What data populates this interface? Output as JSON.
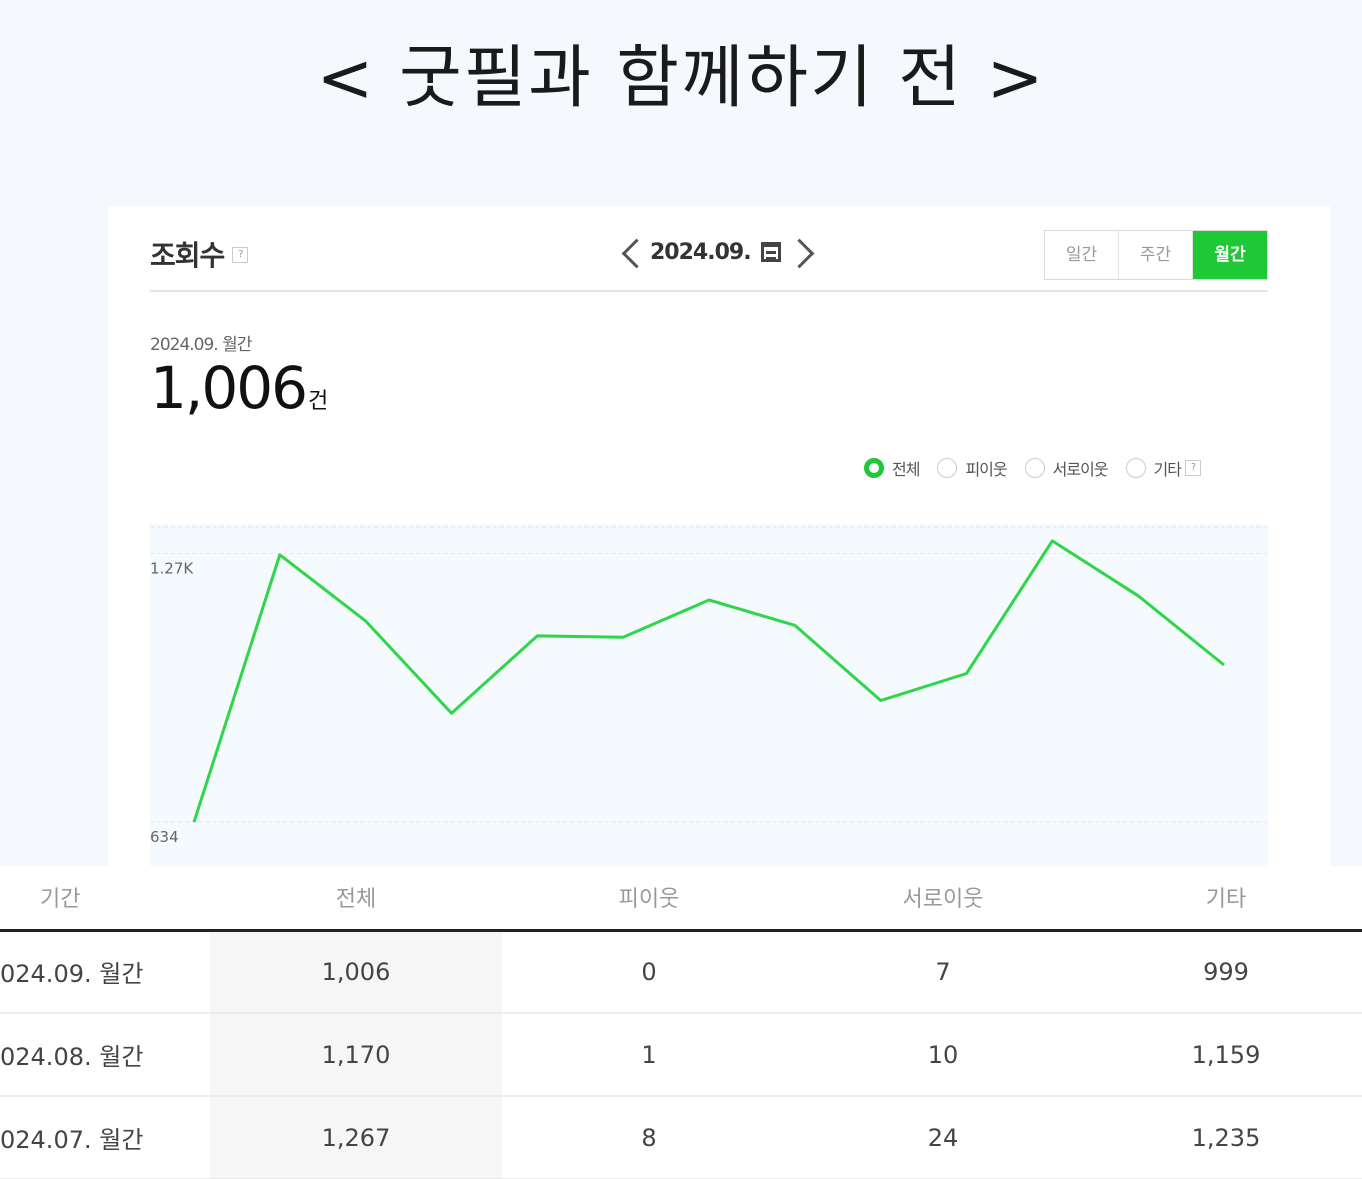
{
  "page": {
    "title": "< 굿필과 함께하기 전 >"
  },
  "card": {
    "title": "조회수",
    "help": "?",
    "date_nav": {
      "date": "2024.09."
    },
    "period_tabs": [
      "일간",
      "주간",
      "월간"
    ],
    "active_tab": "월간",
    "summary": {
      "date": "2024.09. 월간",
      "value": "1,006",
      "unit": "건"
    },
    "legend": [
      {
        "label": "전체",
        "checked": true
      },
      {
        "label": "피이웃",
        "checked": false
      },
      {
        "label": "서로이웃",
        "checked": false
      },
      {
        "label": "기타",
        "checked": false
      }
    ],
    "legend_help": "?"
  },
  "colors": {
    "accent": "#1ec836",
    "line": "#2fd648"
  },
  "chart_data": {
    "type": "line",
    "ticks": [
      "1.27K",
      "634"
    ],
    "tick_values": [
      1270,
      634
    ],
    "values": [
      634,
      1267,
      1110,
      892,
      1075,
      1072,
      1160,
      1100,
      922,
      986,
      1300,
      1170,
      1006
    ],
    "ylim": [
      530,
      1340
    ],
    "grid": true
  },
  "table": {
    "headers": [
      "기간",
      "전체",
      "피이웃",
      "서로이웃",
      "기타"
    ],
    "rows": [
      [
        "024.09. 월간",
        "1,006",
        "0",
        "7",
        "999"
      ],
      [
        "024.08. 월간",
        "1,170",
        "1",
        "10",
        "1,159"
      ],
      [
        "024.07. 월간",
        "1,267",
        "8",
        "24",
        "1,235"
      ]
    ]
  }
}
